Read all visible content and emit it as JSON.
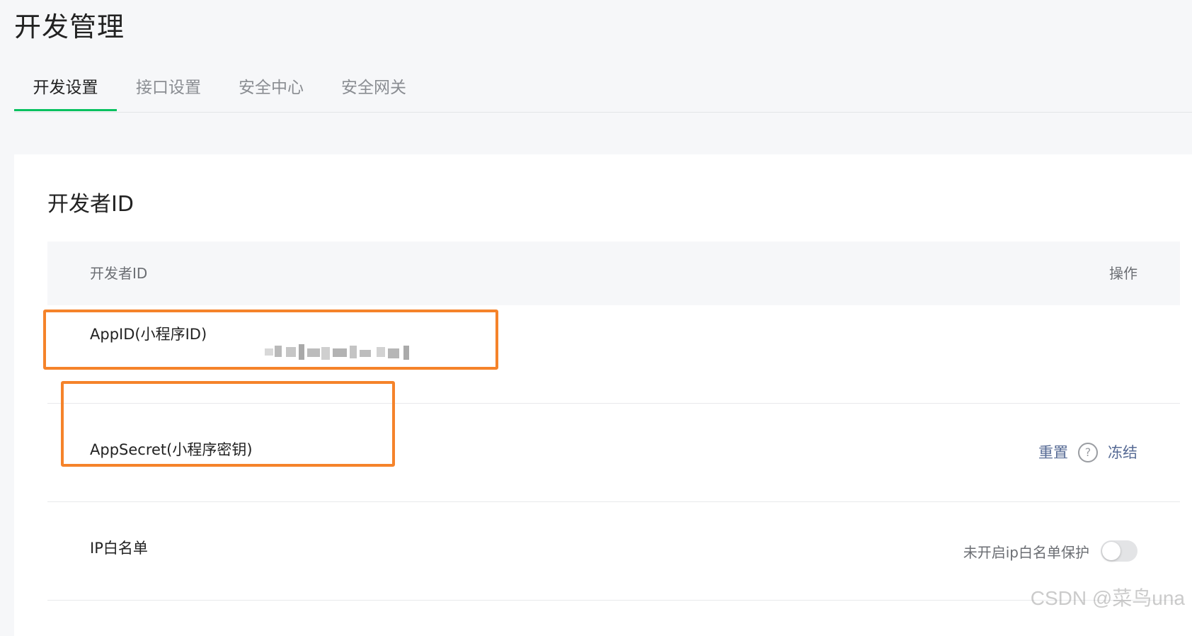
{
  "page": {
    "title": "开发管理"
  },
  "tabs": [
    {
      "label": "开发设置",
      "active": true
    },
    {
      "label": "接口设置",
      "active": false
    },
    {
      "label": "安全中心",
      "active": false
    },
    {
      "label": "安全网关",
      "active": false
    }
  ],
  "card": {
    "title": "开发者ID",
    "table": {
      "header": {
        "left": "开发者ID",
        "right": "操作"
      },
      "rows": [
        {
          "label": "AppID(小程序ID)"
        },
        {
          "label": "AppSecret(小程序密钥)",
          "actions": {
            "reset": "重置",
            "help": "?",
            "freeze": "冻结"
          }
        },
        {
          "label": "IP白名单",
          "toggle_text": "未开启ip白名单保护",
          "toggle_on": false
        }
      ]
    }
  },
  "watermark": "CSDN @菜鸟una",
  "colors": {
    "accent_green": "#07c160",
    "link_blue": "#576b95",
    "highlight_orange": "#f5832a"
  },
  "icons": {
    "help": "help-icon"
  }
}
